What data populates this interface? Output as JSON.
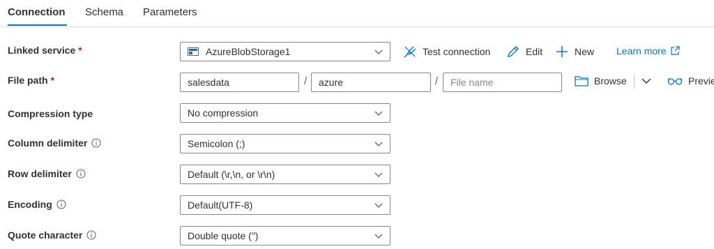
{
  "tabs": [
    {
      "label": "Connection"
    },
    {
      "label": "Schema"
    },
    {
      "label": "Parameters"
    }
  ],
  "linked_service": {
    "label": "Linked service",
    "required_mark": "*",
    "value": "AzureBlobStorage1",
    "icon": "storage-icon",
    "actions": {
      "test_connection": "Test connection",
      "edit": "Edit",
      "new": "New",
      "learn_more": "Learn more"
    }
  },
  "file_path": {
    "label": "File path",
    "required_mark": "*",
    "container": "salesdata",
    "directory": "azure",
    "separator": "/",
    "file_name_placeholder": "File name",
    "browse": "Browse",
    "preview": "Previe"
  },
  "compression_type": {
    "label": "Compression type",
    "value": "No compression"
  },
  "column_delimiter": {
    "label": "Column delimiter",
    "value": "Semicolon (;)"
  },
  "row_delimiter": {
    "label": "Row delimiter",
    "value": "Default (\\r,\\n, or \\r\\n)"
  },
  "encoding": {
    "label": "Encoding",
    "value": "Default(UTF-8)"
  },
  "quote_character": {
    "label": "Quote character",
    "value": "Double quote (\")"
  },
  "colors": {
    "accent": "#0078d4",
    "required": "#a4262c",
    "border": "#8a8886"
  }
}
